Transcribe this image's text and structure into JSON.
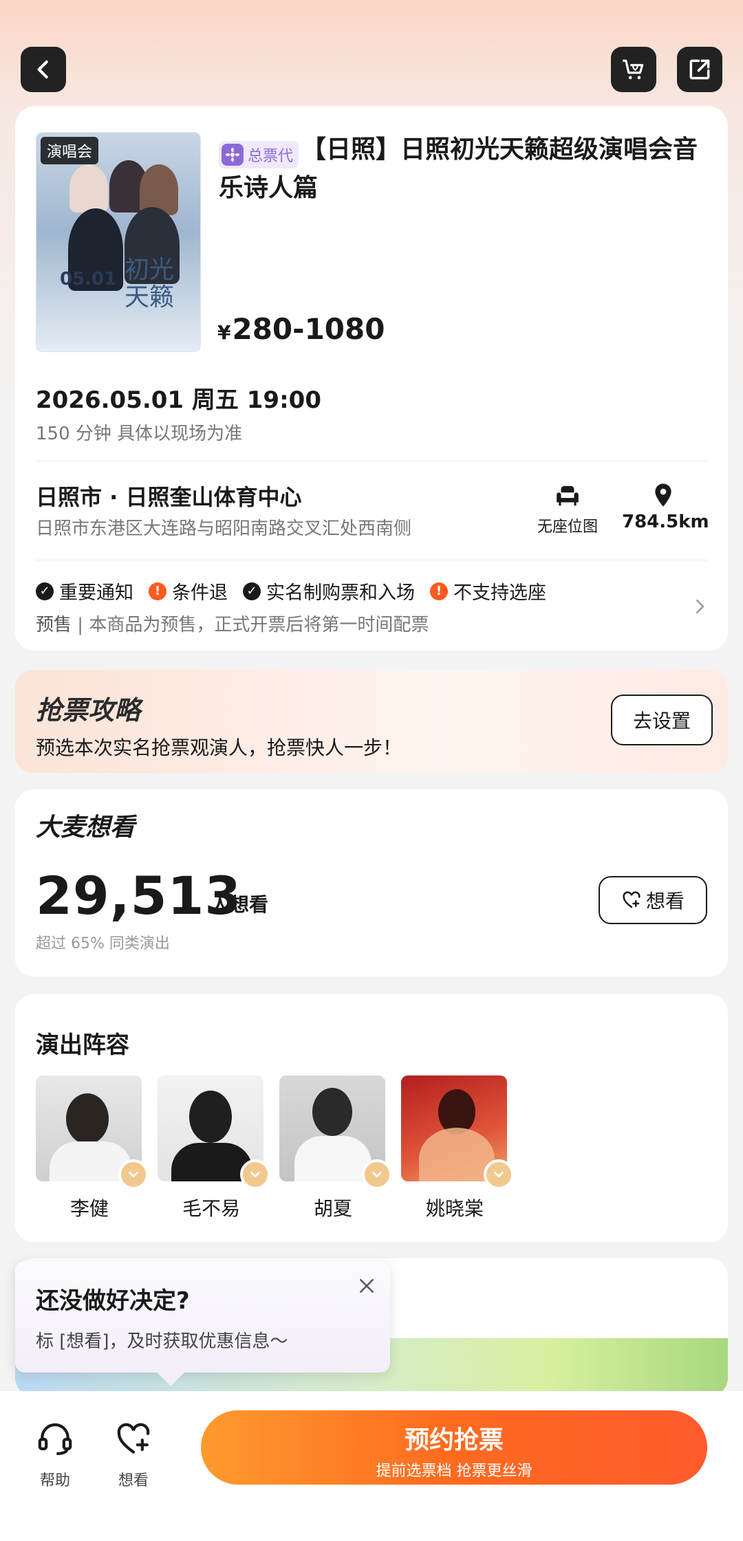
{
  "event": {
    "poster_tag": "演唱会",
    "poster_date": "05.01",
    "poster_title": "初光天籁",
    "agent_badge": "总票代",
    "title": "【日照】日照初光天籁超级演唱会音乐诗人篇",
    "price_symbol": "¥",
    "price_range": "280-1080",
    "datetime": "2026.05.01 周五 19:00",
    "duration": "150 分钟 具体以现场为准"
  },
  "venue": {
    "name": "日照市 · 日照奎山体育中心",
    "address": "日照市东港区大连路与昭阳南路交叉汇处西南侧",
    "seatmap_label": "无座位图",
    "distance": "784.5km"
  },
  "notices": [
    {
      "icon": "check-icon",
      "label": "重要通知"
    },
    {
      "icon": "warning-icon",
      "label": "条件退"
    },
    {
      "icon": "check-icon",
      "label": "实名制购票和入场"
    },
    {
      "icon": "warning-icon",
      "label": "不支持选座"
    }
  ],
  "presale": {
    "label": "预售",
    "separator": " | ",
    "text": "本商品为预售，正式开票后将第一时间配票"
  },
  "strategy": {
    "title": "抢票攻略",
    "subtitle": "预选本次实名抢票观演人，抢票快人一步！",
    "button": "去设置"
  },
  "want": {
    "title": "大麦想看",
    "count": "29,513",
    "suffix": "人想看",
    "subtitle": "超过 65% 同类演出",
    "button": "想看"
  },
  "cast": {
    "title": "演出阵容",
    "members": [
      {
        "name": "李健"
      },
      {
        "name": "毛不易"
      },
      {
        "name": "胡夏"
      },
      {
        "name": "姚晓棠"
      }
    ]
  },
  "popup": {
    "title": "还没做好决定?",
    "subtitle": "标 [想看]，及时获取优惠信息～"
  },
  "bottombar": {
    "help_label": "帮助",
    "want_label": "想看",
    "cta_main": "预约抢票",
    "cta_sub": "提前选票档 抢票更丝滑"
  },
  "colors": {
    "accent_orange": "#ff6a1f",
    "warning": "#ff5a1f",
    "agent_purple": "#8b6ad8",
    "badge_gold": "#f1c88e"
  }
}
